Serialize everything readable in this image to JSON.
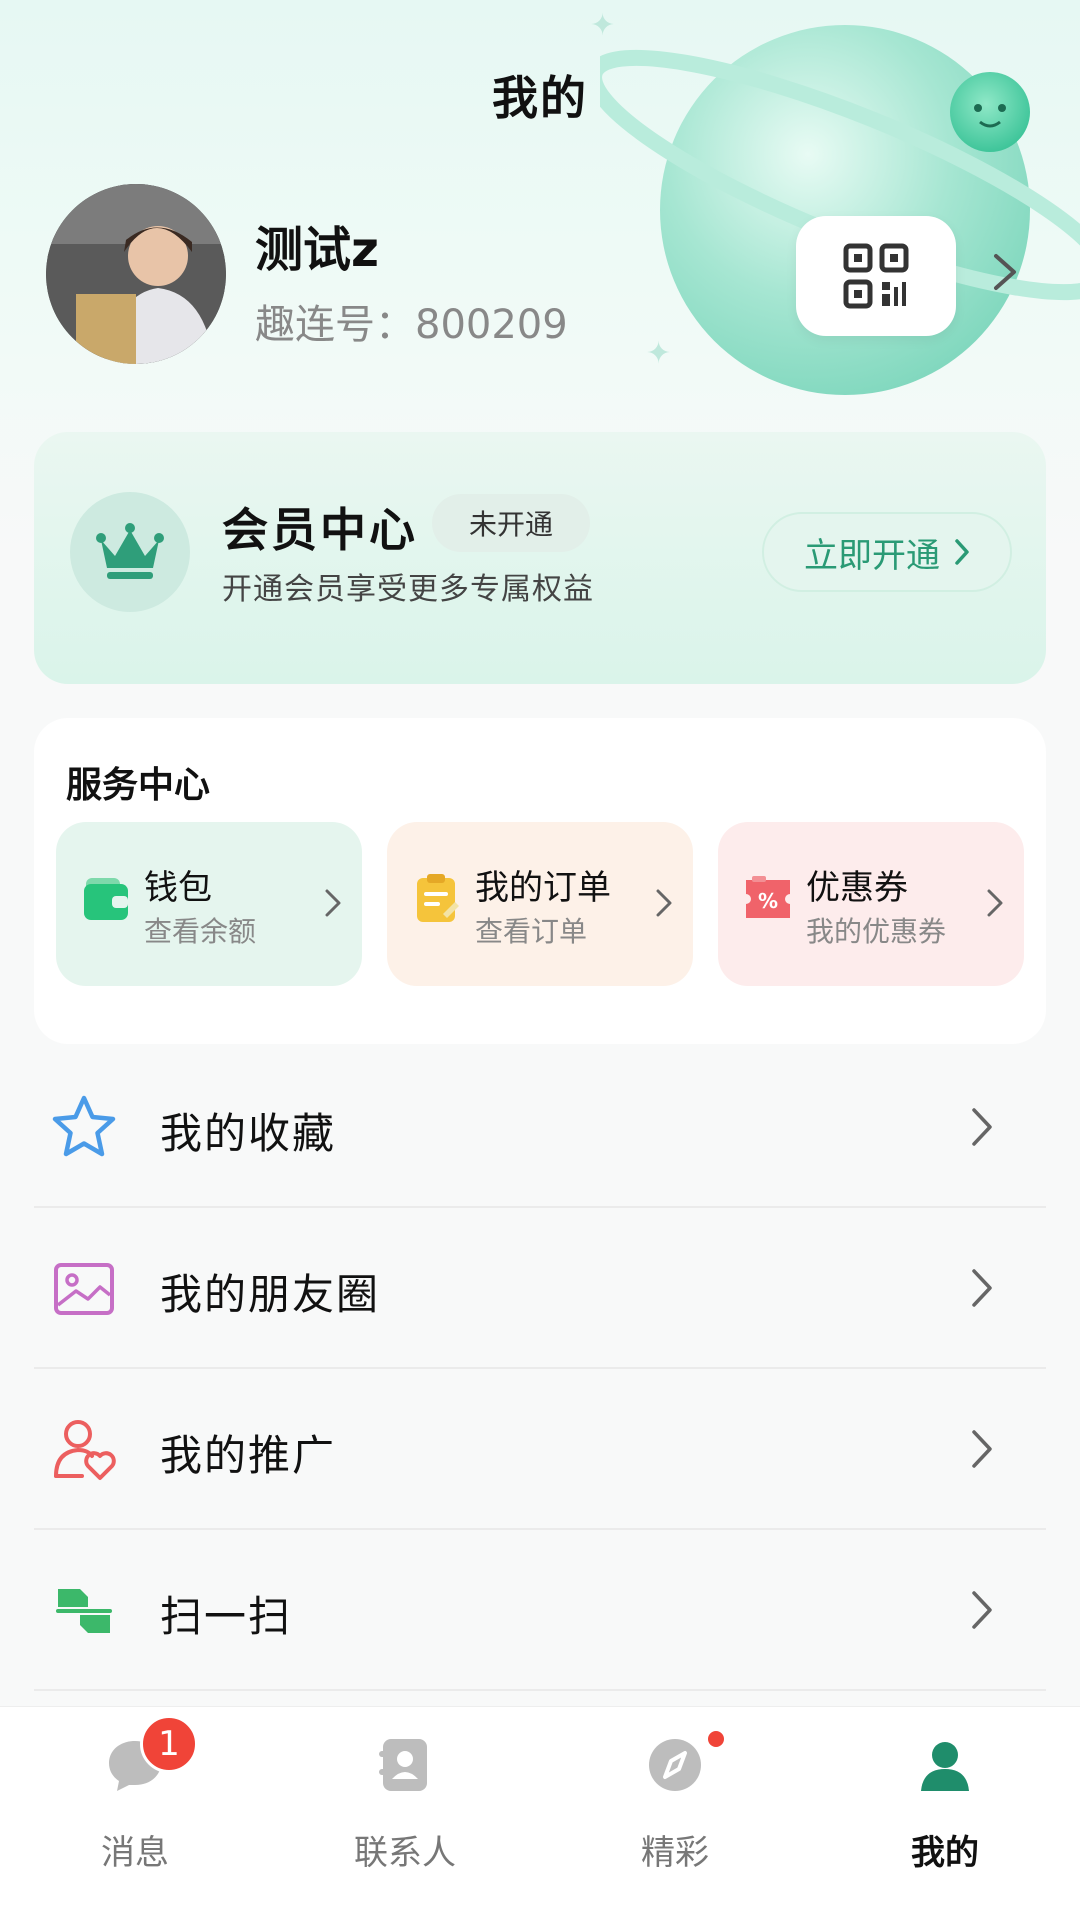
{
  "header": {
    "title": "我的"
  },
  "profile": {
    "name": "测试z",
    "id_label": "趣连号：",
    "id_value": "800209"
  },
  "member": {
    "title": "会员中心",
    "badge": "未开通",
    "subtitle": "开通会员享受更多专属权益",
    "button": "立即开通"
  },
  "services": {
    "title": "服务中心",
    "items": [
      {
        "title": "钱包",
        "subtitle": "查看余额",
        "icon": "wallet-icon",
        "bg": "#e5f5ee"
      },
      {
        "title": "我的订单",
        "subtitle": "查看订单",
        "icon": "order-icon",
        "bg": "#fdf1e8"
      },
      {
        "title": "优惠券",
        "subtitle": "我的优惠券",
        "icon": "coupon-icon",
        "bg": "#fdecec"
      }
    ]
  },
  "menu": [
    {
      "label": "我的收藏",
      "icon": "star-icon"
    },
    {
      "label": "我的朋友圈",
      "icon": "moments-icon"
    },
    {
      "label": "我的推广",
      "icon": "promotion-icon"
    },
    {
      "label": "扫一扫",
      "icon": "scan-icon"
    }
  ],
  "tabs": [
    {
      "label": "消息",
      "icon": "chat-icon",
      "badge": "1"
    },
    {
      "label": "联系人",
      "icon": "contacts-icon"
    },
    {
      "label": "精彩",
      "icon": "compass-icon"
    },
    {
      "label": "我的",
      "icon": "person-icon",
      "active": true
    }
  ],
  "colors": {
    "accent": "#2a9a75",
    "badge": "#f04438"
  }
}
